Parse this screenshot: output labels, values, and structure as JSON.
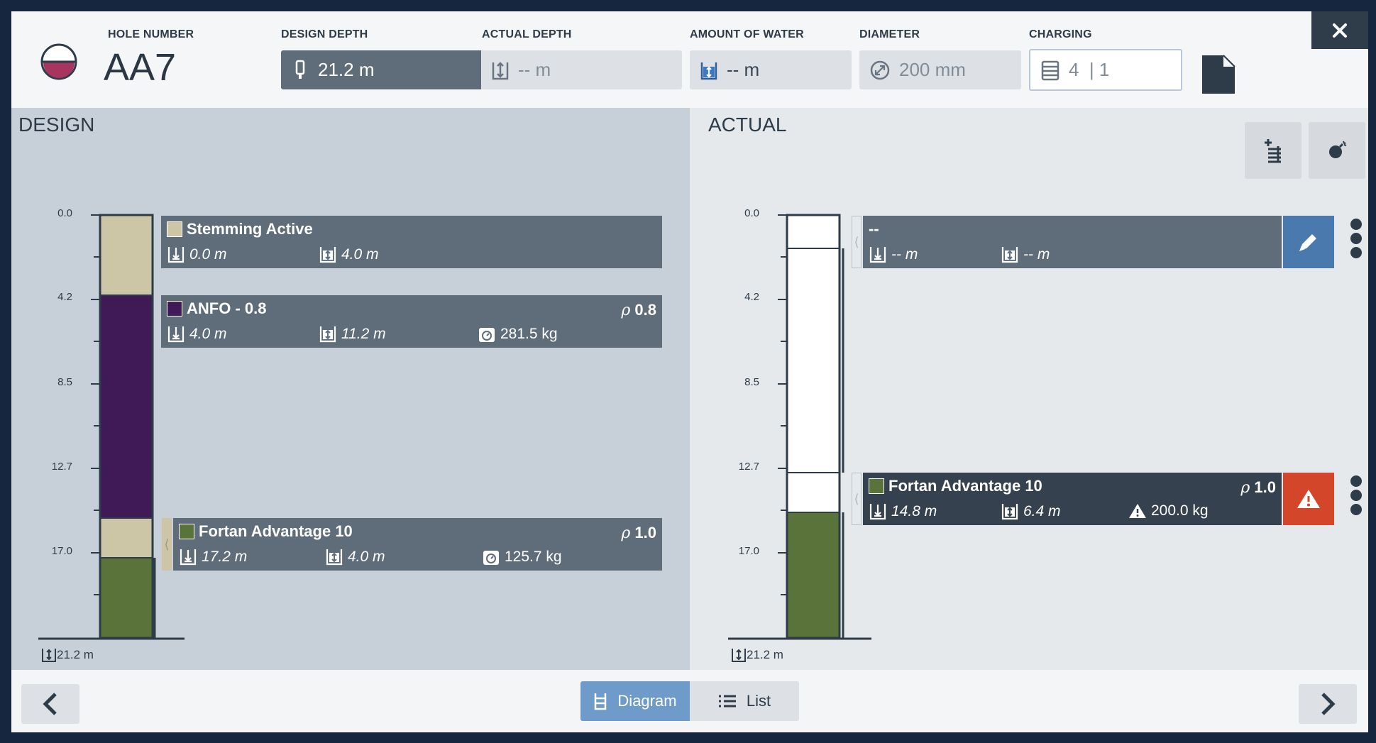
{
  "header": {
    "hole_number_label": "HOLE NUMBER",
    "hole_number": "AA7",
    "design_depth_label": "DESIGN DEPTH",
    "design_depth": "21.2 m",
    "actual_depth_label": "ACTUAL DEPTH",
    "actual_depth": "-- m",
    "water_label": "AMOUNT OF WATER",
    "water": "-- m",
    "diameter_label": "DIAMETER",
    "diameter": "200 mm",
    "charging_label": "CHARGING",
    "charging": "4  | 1",
    "close_label": "✕"
  },
  "design": {
    "title": "DESIGN",
    "ticks": [
      "0.0",
      "4.2",
      "8.5",
      "12.7",
      "17.0"
    ],
    "bottom_depth": "21.2 m",
    "layers": [
      {
        "name": "Stemming Active",
        "top": "0.0 m",
        "length": "4.0 m",
        "color": "#cdc6a6"
      },
      {
        "name": "ANFO - 0.8",
        "top": "4.0 m",
        "length": "11.2 m",
        "weight": "281.5 kg",
        "rho": "0.8",
        "color": "#3f1a57"
      },
      {
        "name": "Fortan Advantage 10",
        "top": "17.2 m",
        "length": "4.0 m",
        "weight": "125.7 kg",
        "rho": "1.0",
        "color": "#5a733a"
      }
    ]
  },
  "actual": {
    "title": "ACTUAL",
    "ticks": [
      "0.0",
      "4.2",
      "8.5",
      "12.7",
      "17.0"
    ],
    "bottom_depth": "21.2 m",
    "layers": [
      {
        "name": "--",
        "top": "-- m",
        "length": "-- m"
      },
      {
        "name": "Fortan Advantage 10",
        "top": "14.8 m",
        "length": "6.4 m",
        "weight": "200.0 kg",
        "rho": "1.0",
        "color": "#5a733a"
      }
    ]
  },
  "footer": {
    "diagram_label": "Diagram",
    "list_label": "List"
  },
  "colors": {
    "accent_blue": "#6e9bc9",
    "edit_blue": "#4a7aad",
    "warning_red": "#d4462a",
    "dark": "#2f3c4a"
  }
}
